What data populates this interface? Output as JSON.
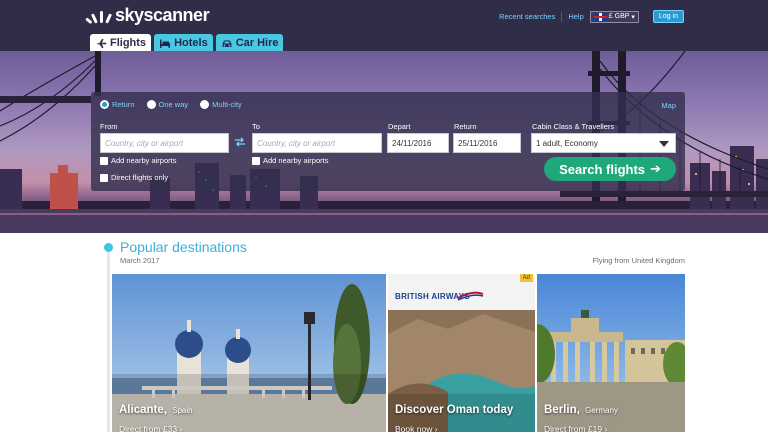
{
  "header": {
    "logo_text": "skyscanner",
    "recent_searches": "Recent searches",
    "help": "Help",
    "currency": "£ GBP",
    "login": "Log in"
  },
  "tabs": [
    {
      "label": "Flights",
      "icon": "plane-icon",
      "active": true
    },
    {
      "label": "Hotels",
      "icon": "bed-icon",
      "active": false
    },
    {
      "label": "Car Hire",
      "icon": "car-icon",
      "active": false
    }
  ],
  "search": {
    "trip_types": [
      "Return",
      "One way",
      "Multi-city"
    ],
    "selected_trip_type": "Return",
    "map_link": "Map",
    "from_label": "From",
    "from_placeholder": "Country, city or airport",
    "to_label": "To",
    "to_placeholder": "Country, city or airport",
    "depart_label": "Depart",
    "depart_value": "24/11/2016",
    "return_label": "Return",
    "return_value": "25/11/2016",
    "cabin_label": "Cabin Class & Travellers",
    "cabin_value": "1 adult, Economy",
    "nearby_from": "Add nearby airports",
    "nearby_to": "Add nearby airports",
    "direct_only": "Direct flights only",
    "search_button": "Search flights"
  },
  "popular": {
    "title": "Popular destinations",
    "date": "March 2017",
    "flying_from": "Flying from United Kingdom",
    "cards": [
      {
        "city": "Alicante,",
        "country": "Spain",
        "sub": "Direct from £33"
      },
      {
        "city": "Discover Oman today",
        "country": "",
        "sub": "Book now",
        "ad": "Ad",
        "brand": "BRITISH AIRWAYS"
      },
      {
        "city": "Berlin,",
        "country": "Germany",
        "sub": "Direct from £19"
      }
    ]
  },
  "colors": {
    "header_bg": "#2f2d48",
    "accent_cyan": "#3cc6e0",
    "search_green": "#1fa87a",
    "link_blue": "#7ad1ff"
  }
}
